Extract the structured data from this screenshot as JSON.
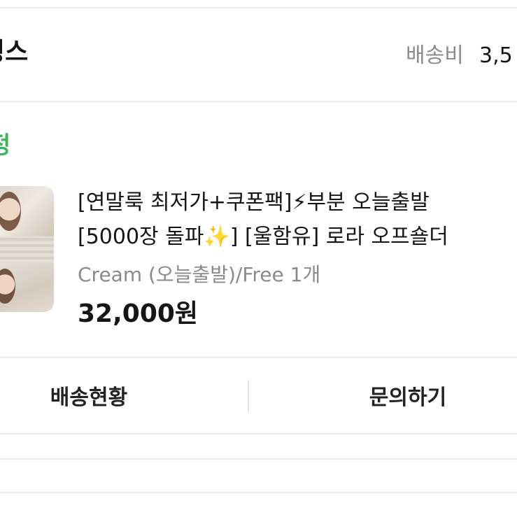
{
  "shop": {
    "name": "빙스",
    "shipping_label": "배송비",
    "shipping_value": "3,5"
  },
  "order": {
    "status": "정"
  },
  "product": {
    "title_line1": "[연말룩 최저가+쿠폰팩]⚡부분 오늘출발",
    "title_line2": "[5000장 돌파✨] [울함유] 로라 오프숄더",
    "option": "Cream (오늘출발)/Free 1개",
    "price": "32,000원"
  },
  "actions": {
    "delivery_status": "배송현황",
    "inquiry": "문의하기"
  }
}
